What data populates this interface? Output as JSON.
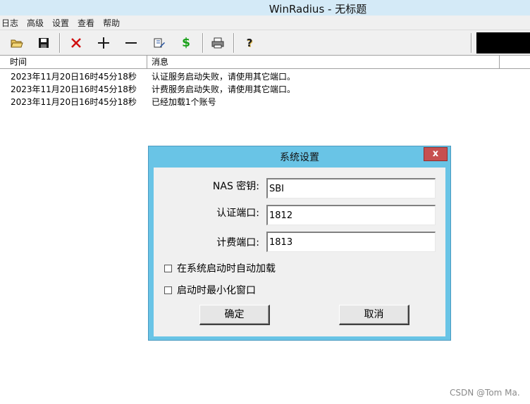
{
  "window": {
    "title": "WinRadius - 无标题"
  },
  "menu": [
    "日志",
    "高级",
    "设置",
    "查看",
    "帮助"
  ],
  "toolbar": {
    "buttons": [
      {
        "icon": "open-folder-icon",
        "color": "#c99b2e"
      },
      {
        "icon": "save-disk-icon",
        "color": "#1a1a1a"
      },
      {
        "icon": "delete-x-icon",
        "color": "#d01010"
      },
      {
        "icon": "plus-icon",
        "color": "#1a1a1a"
      },
      {
        "icon": "minus-icon",
        "color": "#1a1a1a"
      },
      {
        "icon": "edit-icon",
        "color": "#2050a0"
      },
      {
        "icon": "billing-dollar-icon",
        "color": "#18a018"
      },
      {
        "icon": "print-icon",
        "color": "#333333"
      },
      {
        "icon": "help-question-icon",
        "color": "#c99b2e"
      }
    ]
  },
  "log": {
    "columns": [
      "时间",
      "消息"
    ],
    "rows": [
      {
        "time": "2023年11月20日16时45分18秒",
        "message": "认证服务启动失败，请使用其它端口。"
      },
      {
        "time": "2023年11月20日16时45分18秒",
        "message": "计费服务启动失败，请使用其它端口。"
      },
      {
        "time": "2023年11月20日16时45分18秒",
        "message": "已经加载1个账号"
      }
    ]
  },
  "dialog": {
    "title": "系统设置",
    "close_label": "x",
    "fields": {
      "nas_key": {
        "label": "NAS 密钥:",
        "value": "SBI"
      },
      "auth_port": {
        "label": "认证端口:",
        "value": "1812"
      },
      "acct_port": {
        "label": "计费端口:",
        "value": "1813"
      }
    },
    "checkboxes": {
      "autoload": {
        "label": "在系统启动时自动加载",
        "checked": false
      },
      "minimize": {
        "label": "启动时最小化窗口",
        "checked": false
      }
    },
    "ok_label": "确定",
    "cancel_label": "取消"
  },
  "watermark": "CSDN @Tom Ma."
}
